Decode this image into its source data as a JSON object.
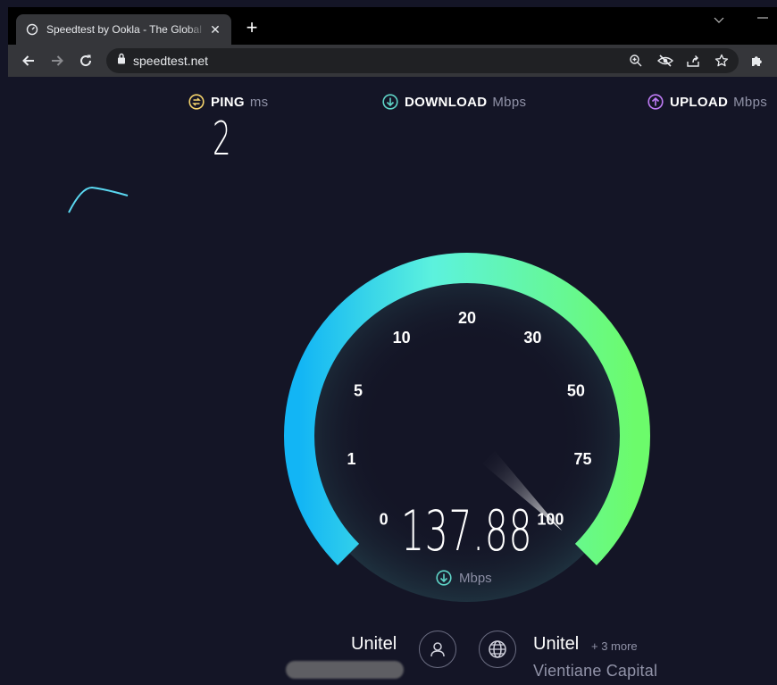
{
  "browser": {
    "tab_title": "Speedtest by Ookla - The Global Broadband Speed Test",
    "tab_close": "✕",
    "new_tab": "+",
    "url": "speedtest.net"
  },
  "stats": {
    "ping": {
      "label": "PING",
      "unit": "ms",
      "value": "2"
    },
    "download": {
      "label": "DOWNLOAD",
      "unit": "Mbps"
    },
    "upload": {
      "label": "UPLOAD",
      "unit": "Mbps"
    }
  },
  "gauge": {
    "ticks": [
      "0",
      "1",
      "5",
      "10",
      "20",
      "30",
      "50",
      "75",
      "100"
    ],
    "needle_value_mbps": 137.88,
    "speed": "137.88",
    "unit": "Mbps"
  },
  "connection": {
    "isp": "Unitel",
    "server": "Unitel",
    "more_servers": "+ 3 more",
    "location": "Vientiane Capital"
  },
  "colors": {
    "background": "#141526",
    "gauge_start": "#12b5f5",
    "gauge_mid": "#5cf2dd",
    "gauge_end": "#6cfb6b",
    "ping_icon": "#f4d36b",
    "download_icon": "#5fd4c7",
    "upload_icon": "#c07cf7"
  }
}
